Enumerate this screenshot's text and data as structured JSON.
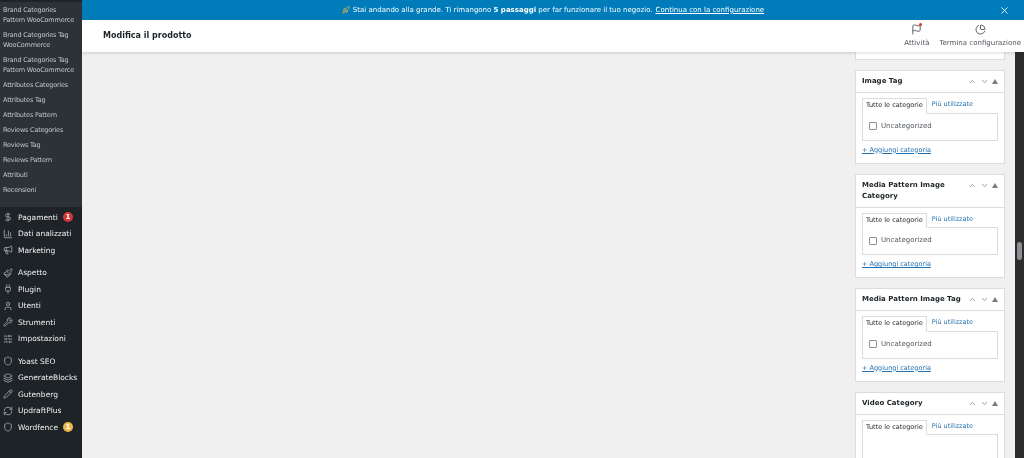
{
  "sidebar": {
    "submenu": [
      "Brand Categories Pattern WooCommerce",
      "Brand Categories Tag WooCommerce",
      "Brand Categories Tag Pattern WooCommerce",
      "Attributes Categories",
      "Attributes Tag",
      "Attributes Pattern",
      "Reviews Categories",
      "Reviews Tag",
      "Reviews Pattern",
      "Attributi",
      "Recensioni"
    ],
    "menu_groups": [
      [
        {
          "label": "Pagamenti",
          "badge": {
            "text": "1",
            "color": "#d63638"
          }
        },
        {
          "label": "Dati analizzati"
        },
        {
          "label": "Marketing"
        }
      ],
      [
        {
          "label": "Aspetto"
        },
        {
          "label": "Plugin"
        },
        {
          "label": "Utenti"
        },
        {
          "label": "Strumenti"
        },
        {
          "label": "Impostazioni"
        }
      ],
      [
        {
          "label": "Yoast SEO"
        },
        {
          "label": "GenerateBlocks"
        },
        {
          "label": "Gutenberg"
        },
        {
          "label": "UpdraftPlus"
        },
        {
          "label": "Wordfence",
          "badge": {
            "text": "1",
            "color": "#f0b849"
          }
        }
      ]
    ]
  },
  "banner": {
    "text_before": "Stai andando alla grande. Ti rimangono **5 passaggi** per far funzionare il tuo negozio.",
    "link": "Continua con la configurazione"
  },
  "header": {
    "title": "Modifica il prodotto",
    "actions": [
      {
        "label": "Attività"
      },
      {
        "label": "Termina configurazione"
      }
    ]
  },
  "boxes": [
    {
      "title": "Image Tag",
      "tabs": [
        {
          "label": "Tutte le categorie",
          "selected": true
        },
        {
          "label": "Più utilizzate",
          "selected": false
        }
      ],
      "items": [
        {
          "label": "Uncategorized",
          "checked": false
        }
      ],
      "add_link": "+ Aggiungi categoria"
    },
    {
      "title": "Media Pattern Image Category",
      "tabs": [
        {
          "label": "Tutte le categorie",
          "selected": true
        },
        {
          "label": "Più utilizzate",
          "selected": false
        }
      ],
      "items": [
        {
          "label": "Uncategorized",
          "checked": false
        }
      ],
      "add_link": "+ Aggiungi categoria"
    },
    {
      "title": "Media Pattern Image Tag",
      "tabs": [
        {
          "label": "Tutte le categorie",
          "selected": true
        },
        {
          "label": "Più utilizzate",
          "selected": false
        }
      ],
      "items": [
        {
          "label": "Uncategorized",
          "checked": false
        }
      ],
      "add_link": "+ Aggiungi categoria"
    },
    {
      "title": "Video Category",
      "tabs": [
        {
          "label": "Tutte le categorie",
          "selected": true
        },
        {
          "label": "Più utilizzate",
          "selected": false
        }
      ]
    }
  ]
}
